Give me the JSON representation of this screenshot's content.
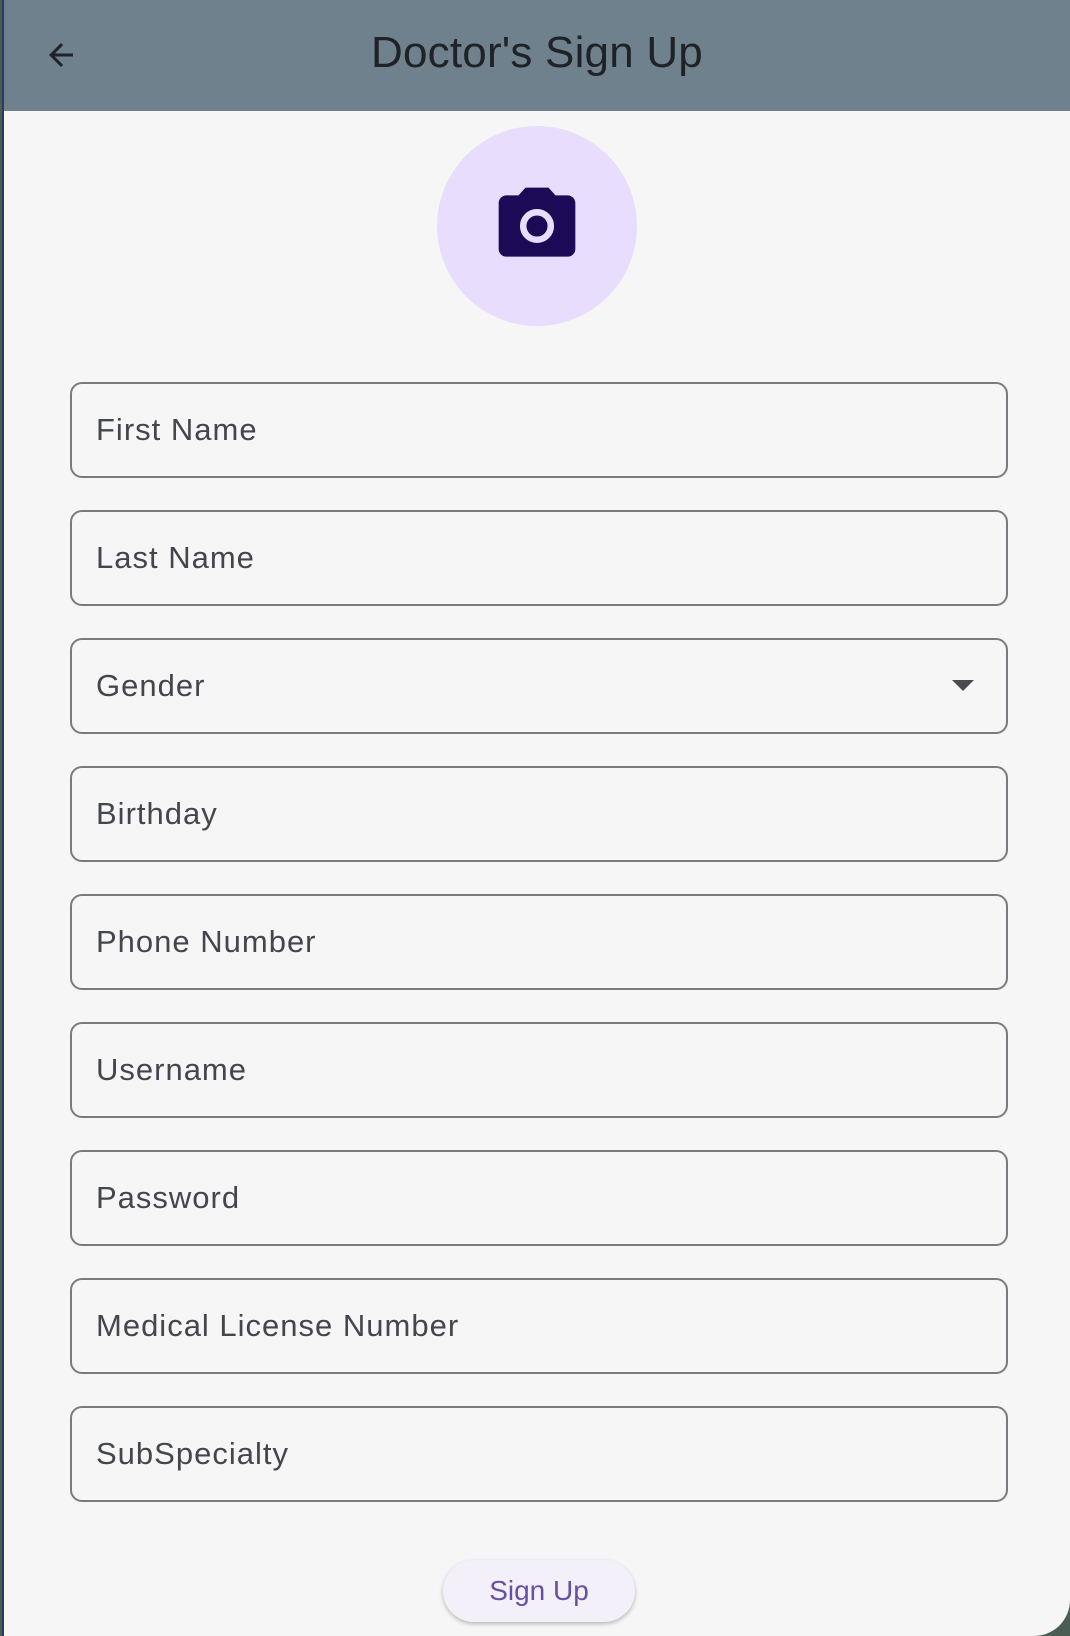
{
  "appbar": {
    "title": "Doctor's Sign Up",
    "back_icon": "arrow-back-icon"
  },
  "avatar": {
    "icon": "camera-icon",
    "colors": {
      "background": "#e9ddfd",
      "icon": "#1d0a57"
    }
  },
  "form": {
    "fields": [
      {
        "name": "first-name",
        "placeholder": "First Name"
      },
      {
        "name": "last-name",
        "placeholder": "Last Name"
      },
      {
        "name": "gender",
        "placeholder": "Gender",
        "type": "dropdown"
      },
      {
        "name": "birthday",
        "placeholder": "Birthday"
      },
      {
        "name": "phone-number",
        "placeholder": "Phone Number"
      },
      {
        "name": "username",
        "placeholder": "Username"
      },
      {
        "name": "password",
        "placeholder": "Password"
      },
      {
        "name": "medical-license-number",
        "placeholder": "Medical License Number"
      },
      {
        "name": "subspecialty",
        "placeholder": "SubSpecialty"
      }
    ],
    "gender": {
      "label": "Gender",
      "icon": "arrow-drop-down-icon"
    },
    "submit_label": "Sign Up"
  },
  "colors": {
    "appbar": "#6f818c",
    "background": "#f6f6f6",
    "accent": "#6750a4",
    "field_border": "#7a7b80"
  }
}
